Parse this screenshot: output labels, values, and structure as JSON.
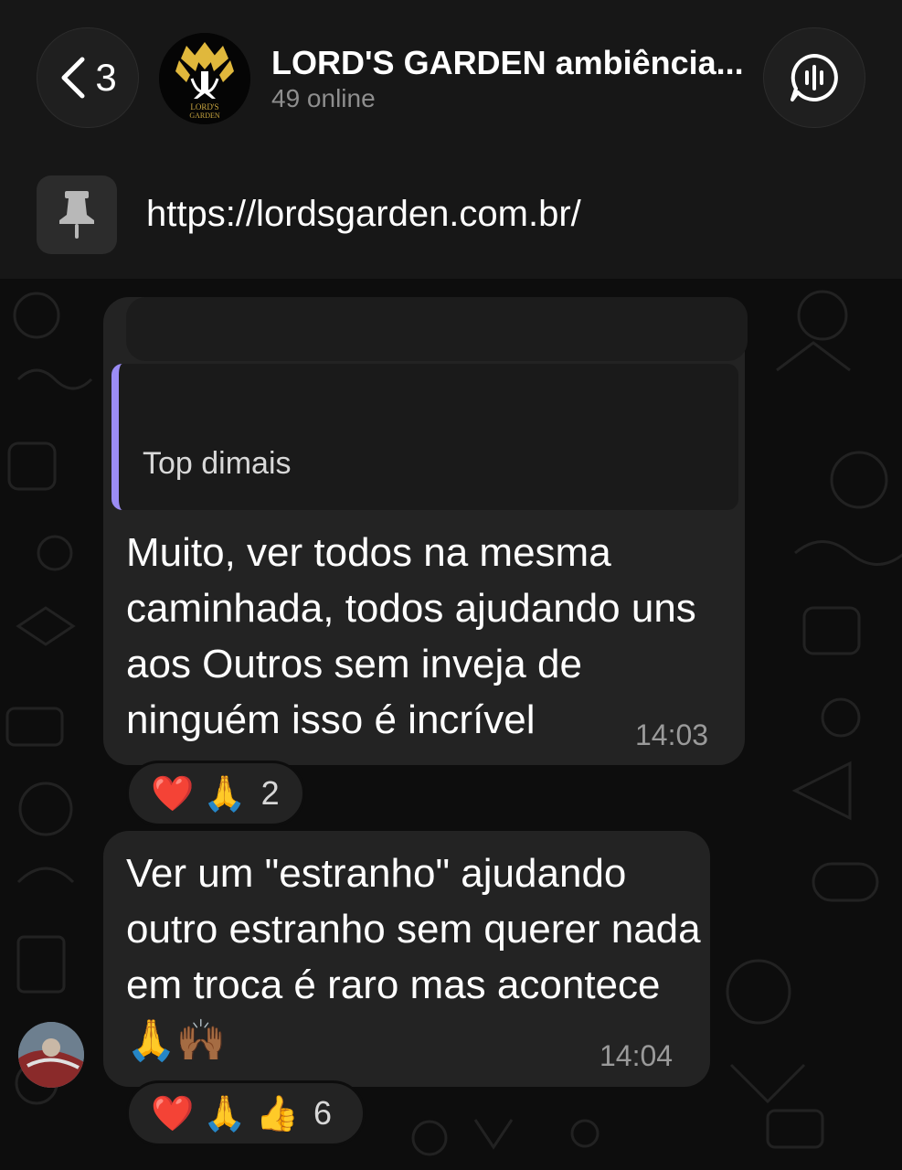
{
  "header": {
    "back_count": "3",
    "title": "LORD'S GARDEN ambiência...",
    "subtitle": "49 online",
    "avatar_text": [
      "LORD'S",
      "GARDEN"
    ]
  },
  "pinned": {
    "text": "https://lordsgarden.com.br/"
  },
  "messages": [
    {
      "quote": "Top dimais",
      "text": "Muito,  ver todos na mesma caminhada, todos ajudando uns aos Outros sem inveja de ninguém isso é incrível",
      "time": "14:03",
      "reactions": {
        "emojis": [
          "❤️",
          "🙏"
        ],
        "count": "2"
      }
    },
    {
      "text": "Ver um \"estranho\" ajudando outro estranho sem querer nada em troca é raro mas acontece 🙏🙌🏾",
      "time": "14:04",
      "reactions": {
        "emojis": [
          "❤️",
          "🙏",
          "👍"
        ],
        "count": "6"
      }
    }
  ],
  "colors": {
    "quote_bar": "#9b8cf5",
    "bubble": "#232323",
    "header_bg": "#171717"
  }
}
